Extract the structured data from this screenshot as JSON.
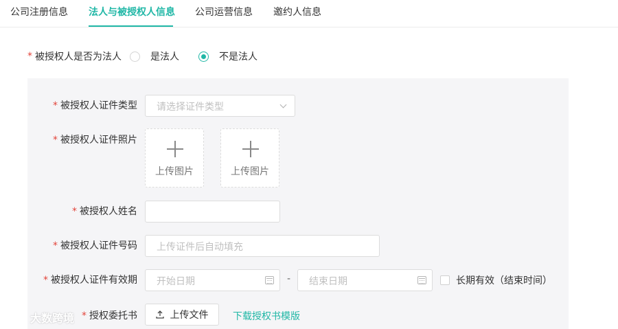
{
  "tabs": [
    {
      "label": "公司注册信息",
      "active": false
    },
    {
      "label": "法人与被授权人信息",
      "active": true
    },
    {
      "label": "公司运营信息",
      "active": false
    },
    {
      "label": "邀约人信息",
      "active": false
    }
  ],
  "question": {
    "required_mark": "*",
    "label": "被授权人是否为法人",
    "options": [
      {
        "label": "是法人",
        "checked": false
      },
      {
        "label": "不是法人",
        "checked": true
      }
    ]
  },
  "form": {
    "id_type": {
      "required_mark": "*",
      "label": "被授权人证件类型",
      "placeholder": "请选择证件类型"
    },
    "id_photo": {
      "required_mark": "*",
      "label": "被授权人证件照片",
      "upload_labels": [
        "上传图片",
        "上传图片"
      ]
    },
    "name": {
      "required_mark": "*",
      "label": "被授权人姓名",
      "value": ""
    },
    "id_number": {
      "required_mark": "*",
      "label": "被授权人证件号码",
      "placeholder": "上传证件后自动填充"
    },
    "validity": {
      "required_mark": "*",
      "label": "被授权人证件有效期",
      "start_placeholder": "开始日期",
      "separator": "-",
      "end_placeholder": "结束日期",
      "long_term_label": "长期有效（结束时间）",
      "long_term_checked": false
    },
    "authorization": {
      "required_mark": "*",
      "label": "授权委托书",
      "upload_button": "上传文件",
      "download_link": "下载授权书模版"
    }
  },
  "colors": {
    "accent": "#20b7a6",
    "required": "#e2443a",
    "panel_bg": "#f5f5f7"
  },
  "watermark": {
    "text": "大数跨境"
  }
}
